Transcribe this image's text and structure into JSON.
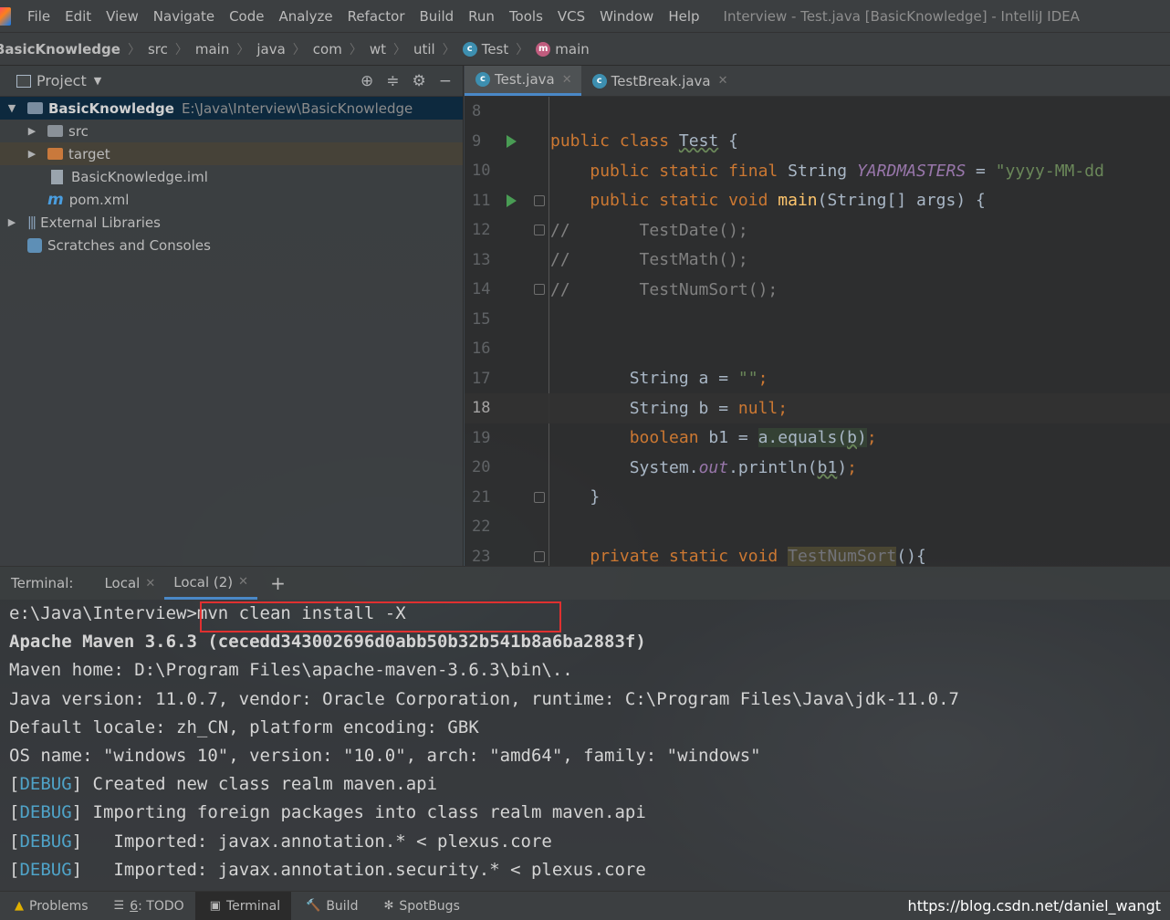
{
  "menubar": {
    "items": [
      "File",
      "Edit",
      "View",
      "Navigate",
      "Code",
      "Analyze",
      "Refactor",
      "Build",
      "Run",
      "Tools",
      "VCS",
      "Window",
      "Help"
    ],
    "window_title": "Interview - Test.java [BasicKnowledge] - IntelliJ IDEA"
  },
  "breadcrumb": [
    "BasicKnowledge",
    "src",
    "main",
    "java",
    "com",
    "wt",
    "util",
    "Test",
    "main"
  ],
  "project": {
    "title": "Project",
    "root_label": "BasicKnowledge",
    "root_path": "E:\\Java\\Interview\\BasicKnowledge",
    "items": [
      "src",
      "target",
      "BasicKnowledge.iml",
      "pom.xml"
    ],
    "external_libraries": "External Libraries",
    "scratches": "Scratches and Consoles"
  },
  "editor": {
    "tabs": [
      "Test.java",
      "TestBreak.java"
    ],
    "line_numbers": [
      "8",
      "9",
      "10",
      "11",
      "12",
      "13",
      "14",
      "15",
      "16",
      "17",
      "18",
      "19",
      "20",
      "21",
      "22",
      "23"
    ],
    "current_line": "18"
  },
  "terminal": {
    "label": "Terminal:",
    "tabs": [
      "Local",
      "Local (2)"
    ],
    "add": "+",
    "lines": [
      "e:\\Java\\Interview>mvn clean install -X",
      "Apache Maven 3.6.3 (cecedd343002696d0abb50b32b541b8a6ba2883f)",
      "Maven home: D:\\Program Files\\apache-maven-3.6.3\\bin\\..",
      "Java version: 11.0.7, vendor: Oracle Corporation, runtime: C:\\Program Files\\Java\\jdk-11.0.7",
      "Default locale: zh_CN, platform encoding: GBK",
      "OS name: \"windows 10\", version: \"10.0\", arch: \"amd64\", family: \"windows\""
    ],
    "debug_tag": "DEBUG",
    "debug_lines": [
      "Created new class realm maven.api",
      "Importing foreign packages into class realm maven.api",
      "  Imported: javax.annotation.* < plexus.core",
      "  Imported: javax.annotation.security.* < plexus.core"
    ]
  },
  "statusbar": {
    "problems": "Problems",
    "todo_num": "6",
    "todo": ": TODO",
    "terminal": "Terminal",
    "build": "Build",
    "spotbugs": "SpotBugs",
    "watermark": "https://blog.csdn.net/daniel_wangt"
  },
  "colors": {
    "accent": "#4a88c7",
    "highlight_box": "#e03030",
    "run_gutter": "#499c54",
    "keyword": "#cc7832",
    "string": "#6a8759"
  }
}
